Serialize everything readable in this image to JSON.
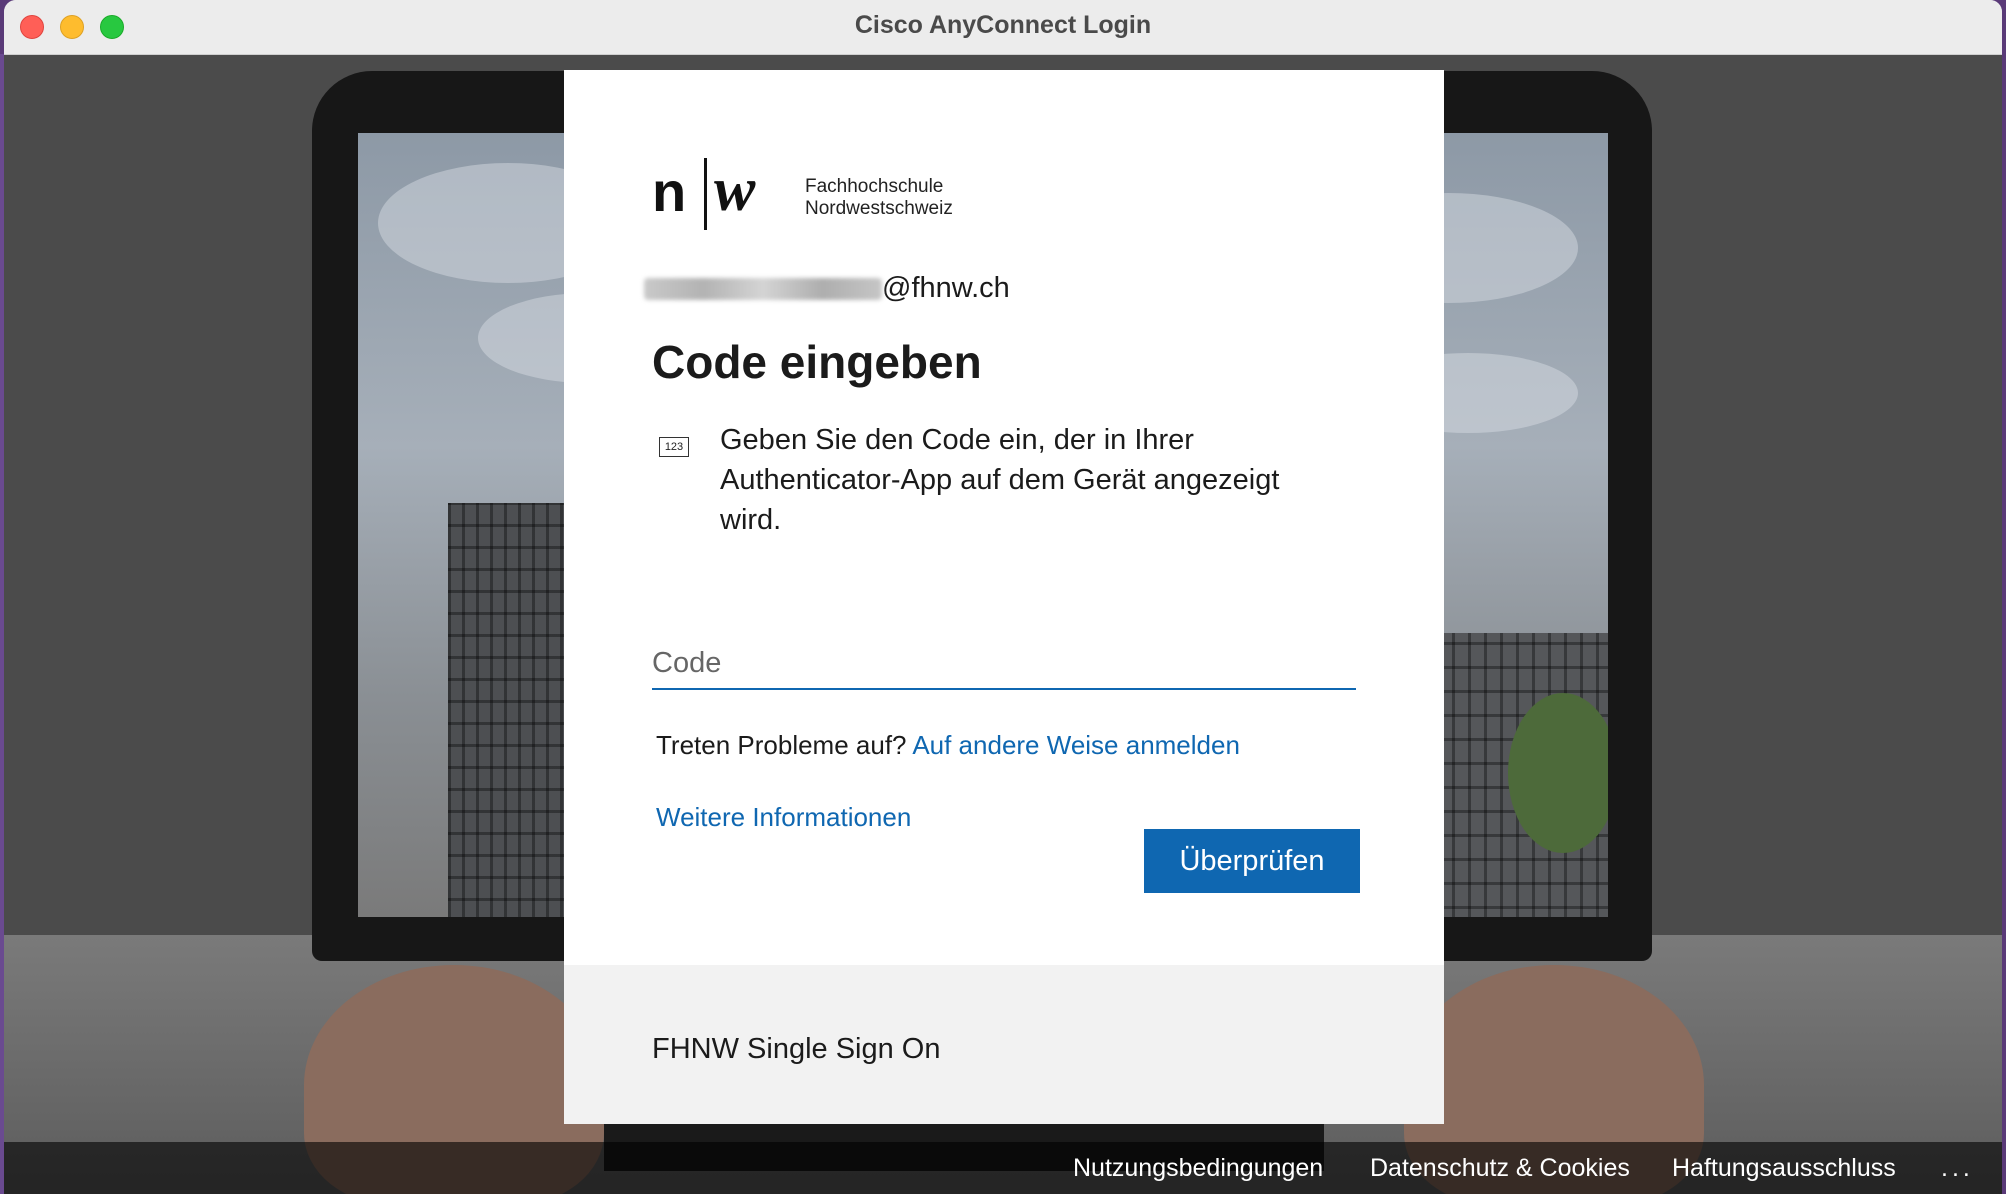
{
  "window": {
    "title": "Cisco AnyConnect Login"
  },
  "dialog": {
    "logo": {
      "line1": "Fachhochschule",
      "line2": "Nordwestschweiz"
    },
    "email_suffix": "@fhnw.ch",
    "heading": "Code eingeben",
    "info_icon_text": "123",
    "info_text": "Geben Sie den Code ein, der in Ihrer Authenticator-App auf dem Gerät angezeigt wird.",
    "code_placeholder": "Code",
    "problems_label": "Treten Probleme auf?",
    "alt_signin_link": "Auf andere Weise anmelden",
    "more_info_link": "Weitere Informationen",
    "verify_button": "Überprüfen",
    "footer": "FHNW Single Sign On"
  },
  "bottom_bar": {
    "terms": "Nutzungsbedingungen",
    "privacy": "Datenschutz & Cookies",
    "disclaimer": "Haftungsausschluss",
    "more": "..."
  },
  "colors": {
    "accent": "#0f67b1",
    "footer_bg": "#f2f2f2"
  }
}
